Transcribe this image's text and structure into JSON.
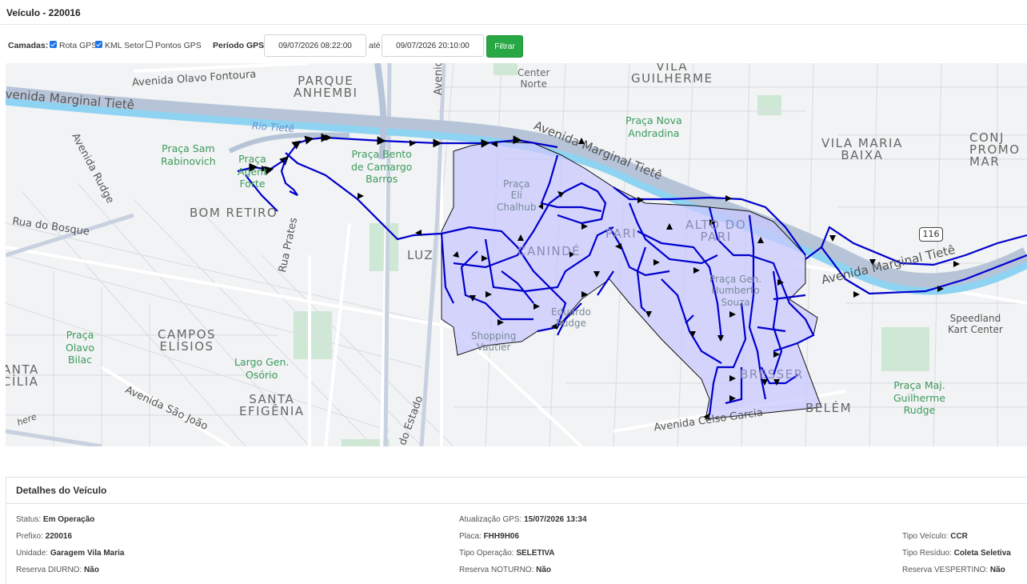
{
  "page": {
    "title": "Veículo - 220016"
  },
  "toolbar": {
    "layers_label": "Camadas:",
    "layers": [
      {
        "label": "Rota GPS",
        "checked": true
      },
      {
        "label": "KML Setor",
        "checked": true
      },
      {
        "label": "Pontos GPS",
        "checked": false
      }
    ],
    "period_label": "Período GPS:",
    "start_value": "09/07/2026 08:22:00",
    "until_label": "até",
    "end_value": "09/07/2026 20:10:00",
    "filter_label": "Filtrar",
    "filter_color": "#28a745"
  },
  "map": {
    "route_color": "#0000cc",
    "sector_fill": "#c8c8ff",
    "labels": {
      "parque_anhembi": "PARQUE\nANHEMBI",
      "vila_guilherme": "VILA\nGUILHERME",
      "vila_maria_baixa": "VILA MARIA\nBAIXA",
      "conj_promocao": "CONJ\nPROMO\nMAR",
      "bom_retiro": "BOM RETIRO",
      "luz": "LUZ",
      "campos_eliseos": "CAMPOS\nELÍSIOS",
      "santa_efigenia": "SANTA\nEFIGÊNIA",
      "belem": "BELÉM",
      "anta_cilia": "ANTA\nCÍLIA",
      "av_olavo_fontoura": "Avenida Olavo Fontoura",
      "av_marginal_tiete_1": "Avenida Marginal Tietê",
      "av_marginal_tiete_2": "Avenida Marginal Tietê",
      "av_marginal_tiete_3": "Avenida Marginal Tietê",
      "av_rudge": "Avenida Rudge",
      "rua_do_bosque": "Rua do Bosque",
      "rua_prates": "Rua Prates",
      "av_cruzeiro_do_sul": "Avenida Cruzeiro do S",
      "av_sao_joao": "Avenida São João",
      "av_do_estado": "do Estado",
      "av_celso_garcia": "Avenida Celso Garcia",
      "rio_tiete": "Rio Tietê",
      "here_logo": "here",
      "center_norte": "Center\nNorte",
      "praca_sam": "Praça Sam\nRabinovich",
      "praca_ag_forte": "Praça\nAgent\nForte",
      "praca_bento": "Praça Bento\nde Camargo\nBarros",
      "praca_nova_andradina": "Praça Nova\nAndradina",
      "praca_olavo_bilac": "Praça\nOlavo\nBilac",
      "largo_osorio": "Largo Gen.\nOsório",
      "praca_maj_guilherme": "Praça Maj.\nGuilherme\nRudge",
      "speedland": "Speedland\nKart Center",
      "pari": "PARI",
      "alto_do_pari": "ALTO DO\nPARI",
      "praca_eli_chalhub": "Praça\nEli\nChalhub",
      "shopping_vautier": "Shopping\nVautier",
      "eduardo_rudge": "Eduardo\nRudge",
      "praca_gen_humberto": "Praça Gen.\nHumberto\nSouza",
      "canindé": "CANINDÉ",
      "bresser": "BRESSER",
      "shield_116": "116"
    }
  },
  "details": {
    "header": "Detalhes do Veículo",
    "col1": [
      {
        "label": "Status:",
        "value": "Em Operação"
      },
      {
        "label": "Prefixo:",
        "value": "220016"
      },
      {
        "label": "Unidade:",
        "value": "Garagem Vila Maria"
      },
      {
        "label": "Reserva DIURNO:",
        "value": "Não"
      }
    ],
    "col2": [
      {
        "label": "Atualização GPS:",
        "value": "15/07/2026 13:34"
      },
      {
        "label": "Placa:",
        "value": "FHH9H06"
      },
      {
        "label": "Tipo Operação:",
        "value": "SELETIVA"
      },
      {
        "label": "Reserva NOTURNO:",
        "value": "Não"
      }
    ],
    "col3": [
      {
        "label": "Tipo Veículo:",
        "value": "CCR"
      },
      {
        "label": "Tipo Resíduo:",
        "value": "Coleta Seletiva"
      },
      {
        "label": "Reserva VESPERTINO:",
        "value": "Não"
      }
    ]
  }
}
